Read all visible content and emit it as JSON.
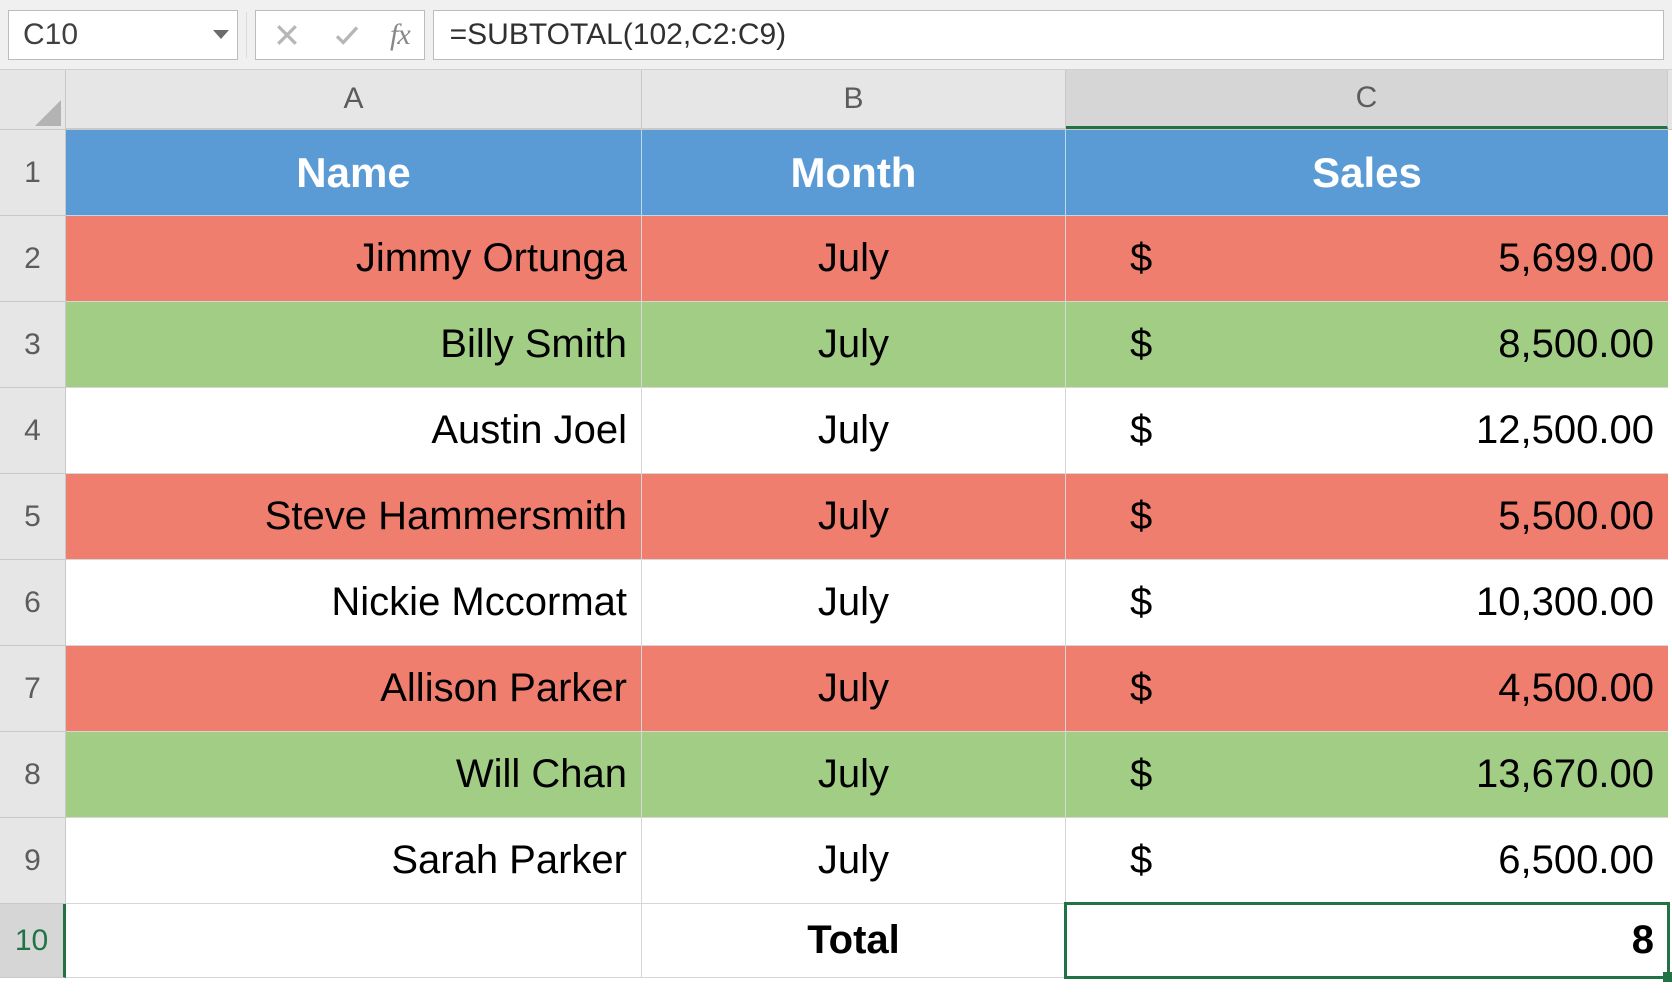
{
  "formula_bar": {
    "cell_ref": "C10",
    "fx_label": "fx",
    "formula": "=SUBTOTAL(102,C2:C9)"
  },
  "columns": {
    "A": "A",
    "B": "B",
    "C": "C"
  },
  "row_numbers": [
    "1",
    "2",
    "3",
    "4",
    "5",
    "6",
    "7",
    "8",
    "9",
    "10"
  ],
  "header": {
    "name": "Name",
    "month": "Month",
    "sales": "Sales"
  },
  "rows": [
    {
      "n": "2",
      "color": "red",
      "name": "Jimmy Ortunga",
      "month": "July",
      "sym": "$",
      "sales": "5,699.00"
    },
    {
      "n": "3",
      "color": "green",
      "name": "Billy Smith",
      "month": "July",
      "sym": "$",
      "sales": "8,500.00"
    },
    {
      "n": "4",
      "color": "white",
      "name": "Austin Joel",
      "month": "July",
      "sym": "$",
      "sales": "12,500.00"
    },
    {
      "n": "5",
      "color": "red",
      "name": "Steve Hammersmith",
      "month": "July",
      "sym": "$",
      "sales": "5,500.00"
    },
    {
      "n": "6",
      "color": "white",
      "name": "Nickie Mccormat",
      "month": "July",
      "sym": "$",
      "sales": "10,300.00"
    },
    {
      "n": "7",
      "color": "red",
      "name": "Allison Parker",
      "month": "July",
      "sym": "$",
      "sales": "4,500.00"
    },
    {
      "n": "8",
      "color": "green",
      "name": "Will Chan",
      "month": "July",
      "sym": "$",
      "sales": "13,670.00"
    },
    {
      "n": "9",
      "color": "white",
      "name": "Sarah Parker",
      "month": "July",
      "sym": "$",
      "sales": "6,500.00"
    }
  ],
  "total": {
    "label": "Total",
    "value": "8"
  },
  "active_cell": "C10",
  "chart_data": {
    "type": "table",
    "title": "",
    "columns": [
      "Name",
      "Month",
      "Sales"
    ],
    "rows": [
      [
        "Jimmy Ortunga",
        "July",
        5699.0
      ],
      [
        "Billy Smith",
        "July",
        8500.0
      ],
      [
        "Austin Joel",
        "July",
        12500.0
      ],
      [
        "Steve Hammersmith",
        "July",
        5500.0
      ],
      [
        "Nickie Mccormat",
        "July",
        10300.0
      ],
      [
        "Allison Parker",
        "July",
        4500.0
      ],
      [
        "Will Chan",
        "July",
        13670.0
      ],
      [
        "Sarah Parker",
        "July",
        6500.0
      ]
    ],
    "total_row": [
      "",
      "Total",
      8
    ]
  }
}
